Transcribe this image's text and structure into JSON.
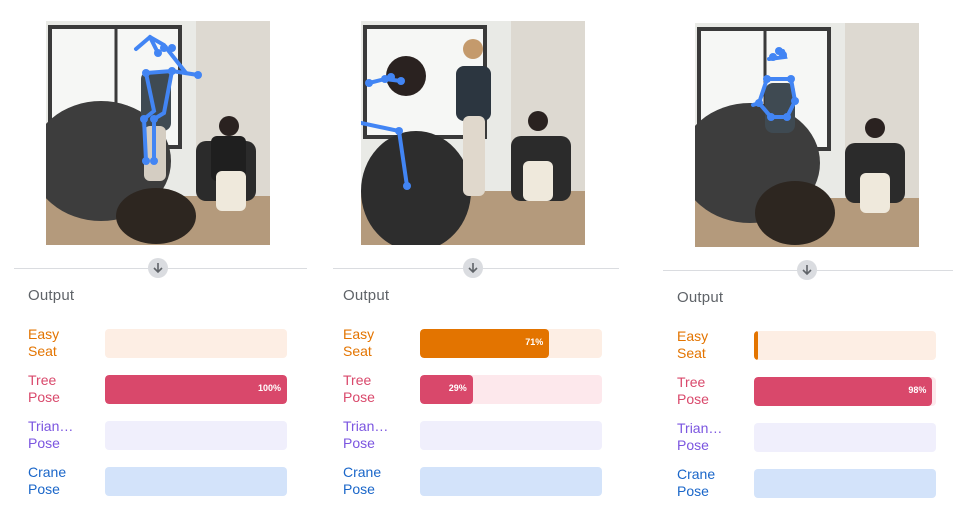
{
  "arrow_icon": "arrow-down-icon",
  "colors": {
    "keypoint": "#4285f4",
    "divider": "#dadce0"
  },
  "poses": [
    {
      "key": "easy",
      "label": "Easy\nSeat",
      "text_color": "#e37400",
      "track_color": "#fdeee4",
      "fill_color": "#e37400"
    },
    {
      "key": "tree",
      "label": "Tree\nPose",
      "text_color": "#d9486b",
      "track_color": "#fde8ec",
      "fill_color": "#d9486b"
    },
    {
      "key": "triangle",
      "label": "Trian…\nPose",
      "text_color": "#7b55e0",
      "track_color": "#f0effc",
      "fill_color": "#7b55e0"
    },
    {
      "key": "crane",
      "label": "Crane\nPose",
      "text_color": "#1a66c9",
      "track_color": "#d3e3fa",
      "fill_color": "#1a66c9"
    }
  ],
  "panels": [
    {
      "output_label": "Output",
      "results": [
        {
          "value": 0,
          "label": ""
        },
        {
          "value": 1.0,
          "label": "100%"
        },
        {
          "value": 0,
          "label": ""
        },
        {
          "value": 0,
          "label": ""
        }
      ]
    },
    {
      "output_label": "Output",
      "results": [
        {
          "value": 0.71,
          "label": "71%"
        },
        {
          "value": 0.29,
          "label": "29%"
        },
        {
          "value": 0,
          "label": ""
        },
        {
          "value": 0,
          "label": ""
        }
      ]
    },
    {
      "output_label": "Output",
      "results": [
        {
          "value": 0.02,
          "label": ""
        },
        {
          "value": 0.98,
          "label": "98%"
        },
        {
          "value": 0,
          "label": ""
        },
        {
          "value": 0,
          "label": ""
        }
      ]
    }
  ]
}
